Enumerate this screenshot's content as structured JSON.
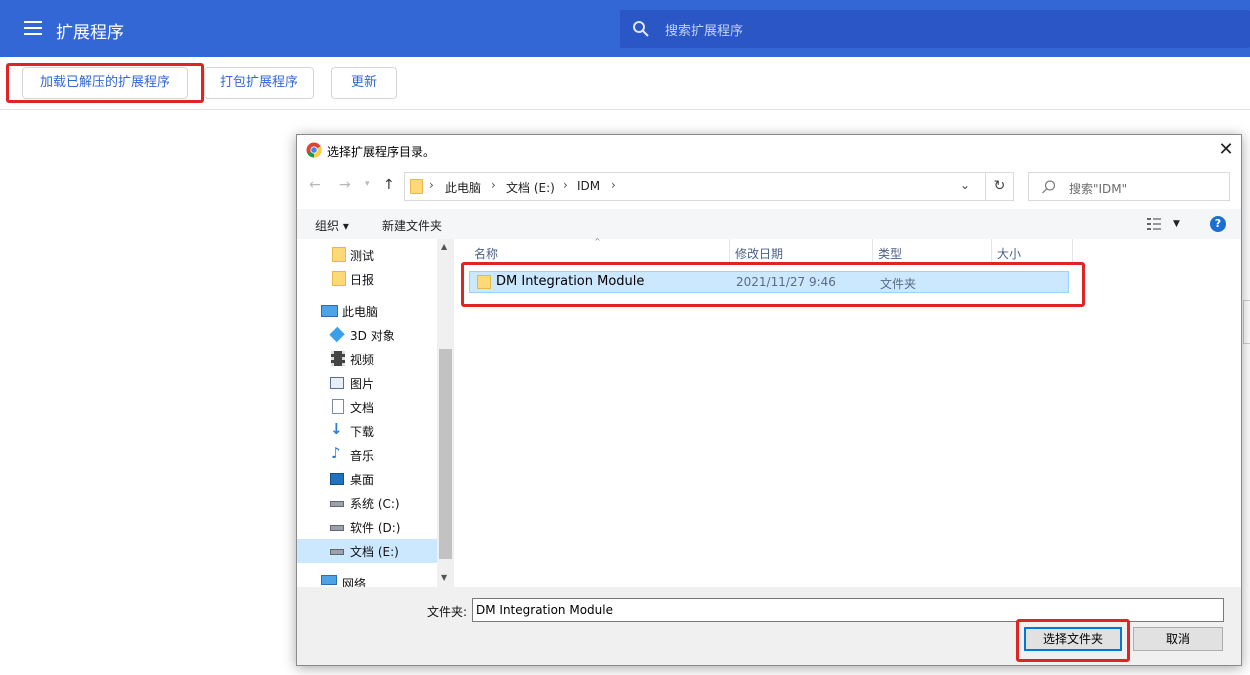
{
  "header": {
    "title": "扩展程序",
    "search_placeholder": "搜索扩展程序"
  },
  "toolbar": {
    "load_unpacked": "加载已解压的扩展程序",
    "pack": "打包扩展程序",
    "update": "更新"
  },
  "dialog": {
    "title": "选择扩展程序目录。",
    "close": "✕",
    "breadcrumb": [
      "此电脑",
      "文档 (E:)",
      "IDM"
    ],
    "search_placeholder": "搜索\"IDM\"",
    "commands": {
      "organize": "组织 ▾",
      "new_folder": "新建文件夹"
    },
    "help": "?",
    "nav_items": [
      {
        "label": "测试",
        "icon": "folder-icon"
      },
      {
        "label": "日报",
        "icon": "folder-icon"
      },
      {
        "label": "此电脑",
        "icon": "computer-icon"
      },
      {
        "label": "3D 对象",
        "icon": "3d-objects-icon"
      },
      {
        "label": "视频",
        "icon": "video-icon"
      },
      {
        "label": "图片",
        "icon": "pictures-icon"
      },
      {
        "label": "文档",
        "icon": "documents-icon"
      },
      {
        "label": "下载",
        "icon": "download-icon"
      },
      {
        "label": "音乐",
        "icon": "music-icon"
      },
      {
        "label": "桌面",
        "icon": "desktop-icon"
      },
      {
        "label": "系统 (C:)",
        "icon": "drive-icon"
      },
      {
        "label": "软件 (D:)",
        "icon": "drive-icon"
      },
      {
        "label": "文档 (E:)",
        "icon": "drive-icon"
      },
      {
        "label": "网络",
        "icon": "network-icon"
      }
    ],
    "columns": {
      "name": "名称",
      "modified": "修改日期",
      "type": "类型",
      "size": "大小"
    },
    "files": [
      {
        "name": "DM Integration Module",
        "modified": "2021/11/27 9:46",
        "type": "文件夹",
        "size": ""
      }
    ],
    "folder_label": "文件夹:",
    "folder_value": "DM Integration Module",
    "select_button": "选择文件夹",
    "cancel_button": "取消"
  },
  "colors": {
    "header_blue": "#3367d6",
    "highlight_red": "#e02424",
    "selection_blue": "#cce8ff"
  }
}
